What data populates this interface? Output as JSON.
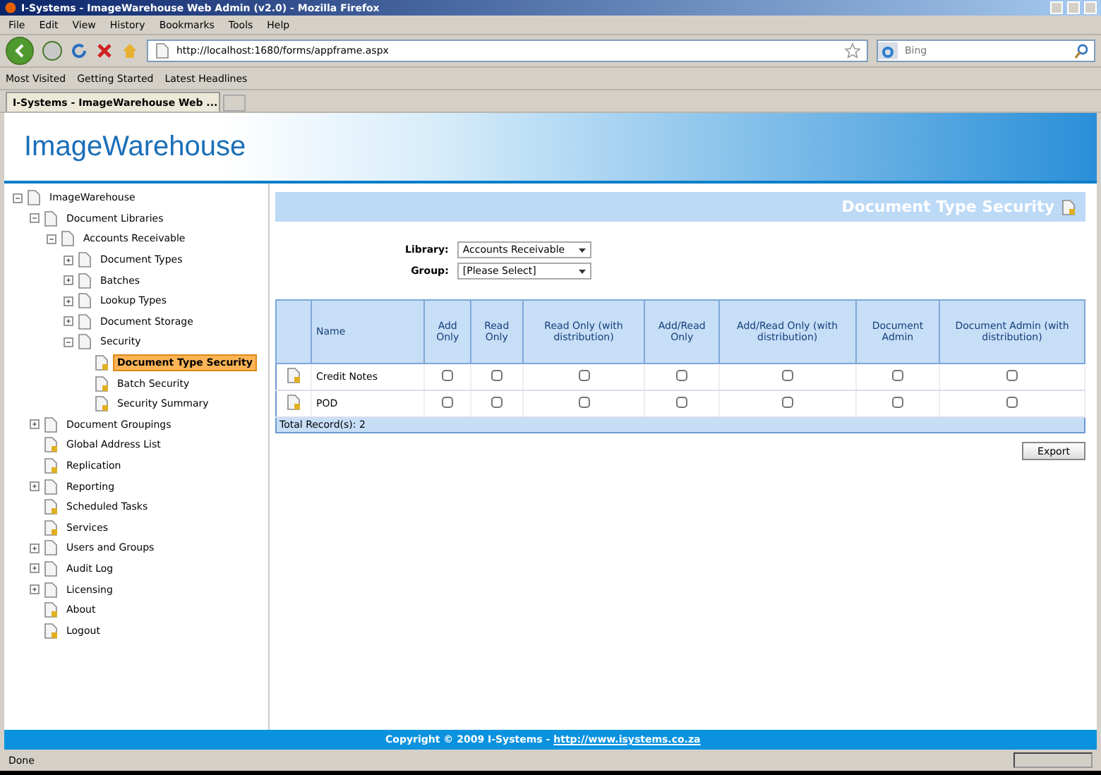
{
  "window": {
    "title": "I-Systems - ImageWarehouse Web Admin (v2.0) - Mozilla Firefox"
  },
  "menu": [
    "File",
    "Edit",
    "View",
    "History",
    "Bookmarks",
    "Tools",
    "Help"
  ],
  "address": {
    "value": "http://localhost:1680/forms/appframe.aspx"
  },
  "search": {
    "placeholder": "Bing"
  },
  "bookmarks": [
    "Most Visited",
    "Getting Started",
    "Latest Headlines"
  ],
  "tabs": [
    {
      "label": "I-Systems - ImageWarehouse Web ...",
      "selected": true
    }
  ],
  "logo": {
    "text": "ImageWarehouse"
  },
  "tree": [
    {
      "label": "ImageWarehouse",
      "kind": "group",
      "expanded": true,
      "selected": false,
      "children": [
        {
          "label": "Document Libraries",
          "kind": "group",
          "expanded": true,
          "selected": false,
          "children": [
            {
              "label": "Accounts Receivable",
              "kind": "group",
              "expanded": true,
              "selected": false,
              "children": [
                {
                  "label": "Document Types",
                  "kind": "group",
                  "expanded": false,
                  "selected": false
                },
                {
                  "label": "Batches",
                  "kind": "group",
                  "expanded": false,
                  "selected": false
                },
                {
                  "label": "Lookup Types",
                  "kind": "group",
                  "expanded": false,
                  "selected": false
                },
                {
                  "label": "Document Storage",
                  "kind": "group",
                  "expanded": false,
                  "selected": false
                },
                {
                  "label": "Security",
                  "kind": "group",
                  "expanded": true,
                  "selected": false,
                  "children": [
                    {
                      "label": "Document Type Security",
                      "kind": "leaf",
                      "selected": true
                    },
                    {
                      "label": "Batch Security",
                      "kind": "leaf",
                      "selected": false
                    },
                    {
                      "label": "Security Summary",
                      "kind": "leaf",
                      "selected": false
                    }
                  ]
                }
              ]
            }
          ]
        },
        {
          "label": "Document Groupings",
          "kind": "group",
          "expanded": false,
          "selected": false
        },
        {
          "label": "Global Address List",
          "kind": "leaf",
          "selected": false
        },
        {
          "label": "Replication",
          "kind": "leaf",
          "selected": false
        },
        {
          "label": "Reporting",
          "kind": "group",
          "expanded": false,
          "selected": false
        },
        {
          "label": "Scheduled Tasks",
          "kind": "leaf",
          "selected": false
        },
        {
          "label": "Services",
          "kind": "leaf",
          "selected": false
        },
        {
          "label": "Users and Groups",
          "kind": "group",
          "expanded": false,
          "selected": false
        },
        {
          "label": "Audit Log",
          "kind": "group",
          "expanded": false,
          "selected": false
        },
        {
          "label": "Licensing",
          "kind": "group",
          "expanded": false,
          "selected": false
        },
        {
          "label": "About",
          "kind": "leaf",
          "selected": false
        },
        {
          "label": "Logout",
          "kind": "leaf",
          "selected": false
        }
      ]
    }
  ],
  "page_title": "Document Type Security",
  "filters": [
    {
      "label": "Library:",
      "value": "Accounts Receivable"
    },
    {
      "label": "Group:",
      "value": "[Please Select]"
    }
  ],
  "table": {
    "columns": [
      "Name",
      "Add Only",
      "Read Only",
      "Read Only (with distribution)",
      "Add/Read Only",
      "Add/Read Only (with distribution)",
      "Document Admin",
      "Document Admin (with distribution)"
    ],
    "rows": [
      {
        "name": "Credit Notes",
        "checks": [
          false,
          false,
          false,
          false,
          false,
          false,
          false
        ]
      },
      {
        "name": "POD",
        "checks": [
          false,
          false,
          false,
          false,
          false,
          false,
          false
        ]
      }
    ],
    "total": "Total Record(s): 2"
  },
  "export_button": "Export",
  "footer": {
    "text": "Copyright © 2009 I-Systems - ",
    "link": "http://www.isystems.co.za"
  },
  "status_bar": "Done"
}
